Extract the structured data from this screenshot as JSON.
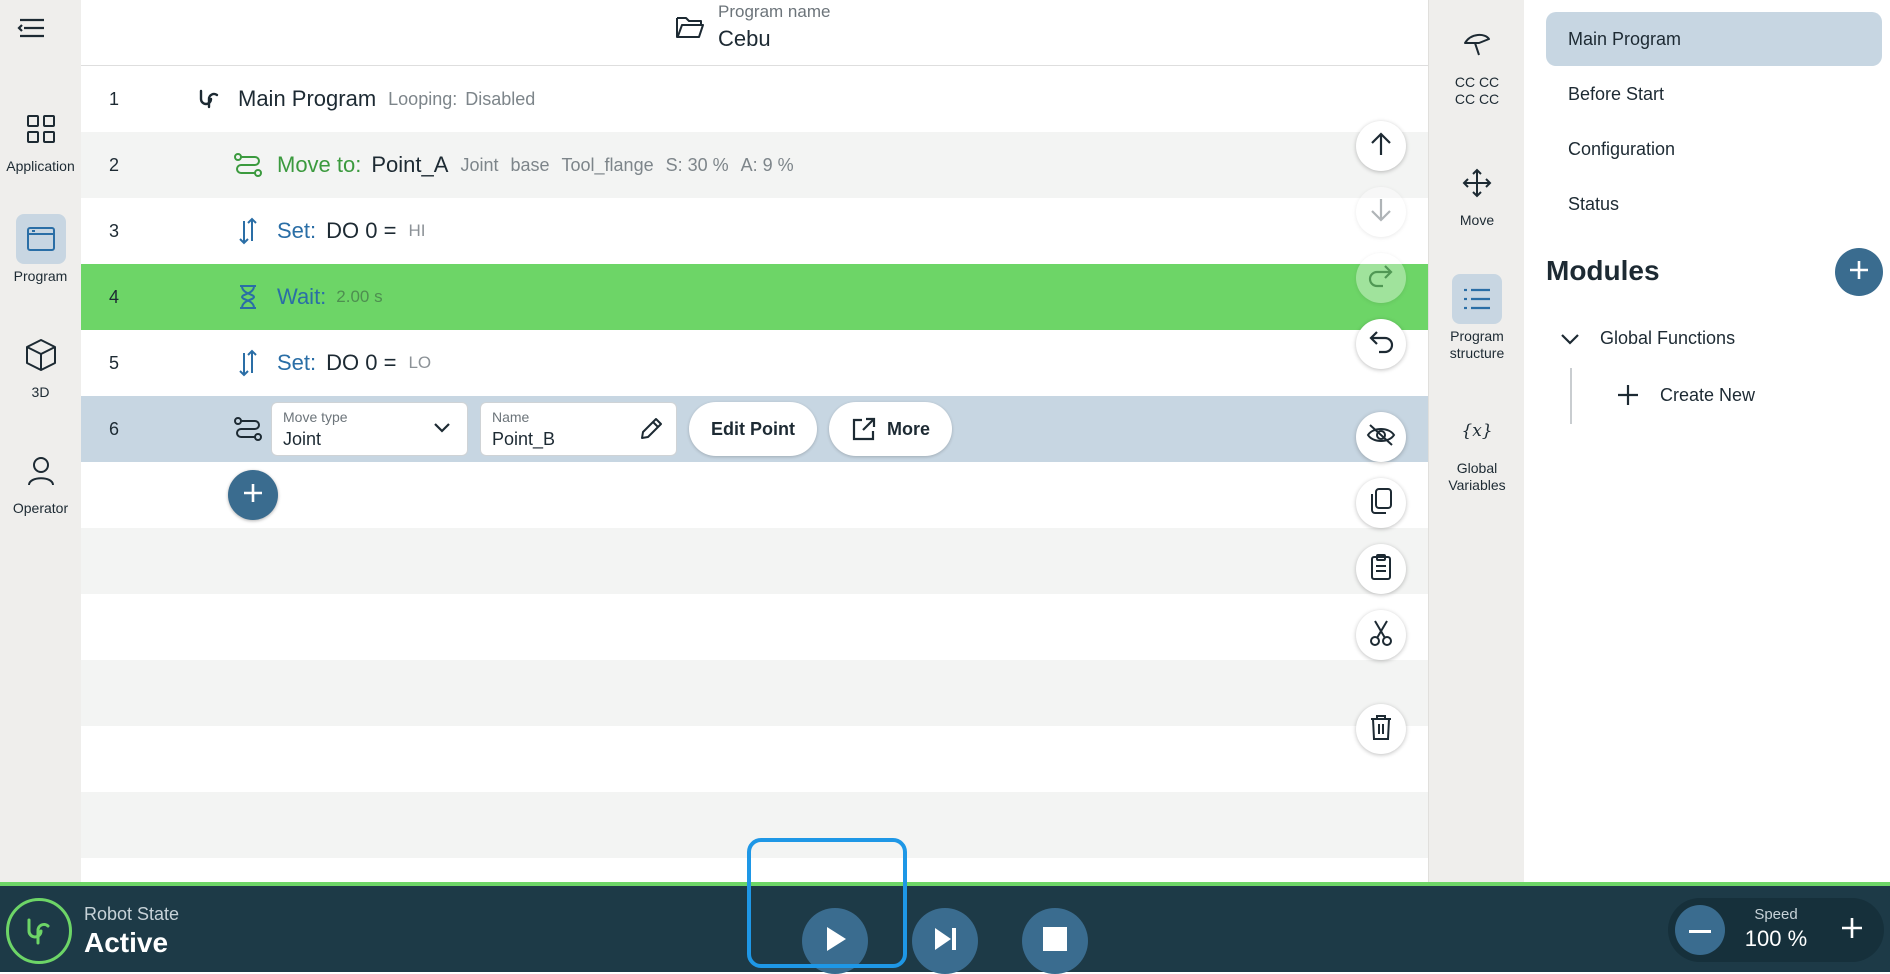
{
  "left_nav": {
    "items": [
      {
        "label": "Application"
      },
      {
        "label": "Program"
      },
      {
        "label": "3D"
      },
      {
        "label": "Operator"
      }
    ]
  },
  "header": {
    "program_label": "Program name",
    "program_name": "Cebu"
  },
  "rows": [
    {
      "num": "1",
      "title": "Main Program",
      "meta1": "Looping:",
      "meta2": "Disabled"
    },
    {
      "num": "2",
      "keyword": "Move to:",
      "target": "Point_A",
      "m1": "Joint",
      "m2": "base",
      "m3": "Tool_flange",
      "m4": "S: 30 %",
      "m5": "A: 9 %"
    },
    {
      "num": "3",
      "keyword": "Set:",
      "target": "DO 0 =",
      "value": "HI"
    },
    {
      "num": "4",
      "keyword": "Wait:",
      "value": "2.00 s"
    },
    {
      "num": "5",
      "keyword": "Set:",
      "target": "DO 0 =",
      "value": "LO"
    },
    {
      "num": "6",
      "move_type_label": "Move type",
      "move_type_value": "Joint",
      "name_label": "Name",
      "name_value": "Point_B",
      "edit_point": "Edit Point",
      "more": "More"
    }
  ],
  "right_icons": {
    "items": [
      {
        "label1": "CC CC",
        "label2": "CC CC"
      },
      {
        "label1": "Move"
      },
      {
        "label1": "Program",
        "label2": "structure"
      },
      {
        "label1": "Global",
        "label2": "Variables"
      }
    ]
  },
  "right_panel": {
    "items": [
      "Main Program",
      "Before Start",
      "Configuration",
      "Status"
    ],
    "modules_title": "Modules",
    "tree": {
      "group": "Global Functions",
      "create": "Create New"
    }
  },
  "footer": {
    "robot_state_label": "Robot State",
    "robot_state_value": "Active",
    "speed_label": "Speed",
    "speed_value": "100 %"
  },
  "colors": {
    "accent": "#3a6c8f",
    "current_row": "#6dd567",
    "selected_row": "#c7d6e2",
    "footer_bg": "#1d3a47",
    "highlight": "#1e97e6"
  }
}
